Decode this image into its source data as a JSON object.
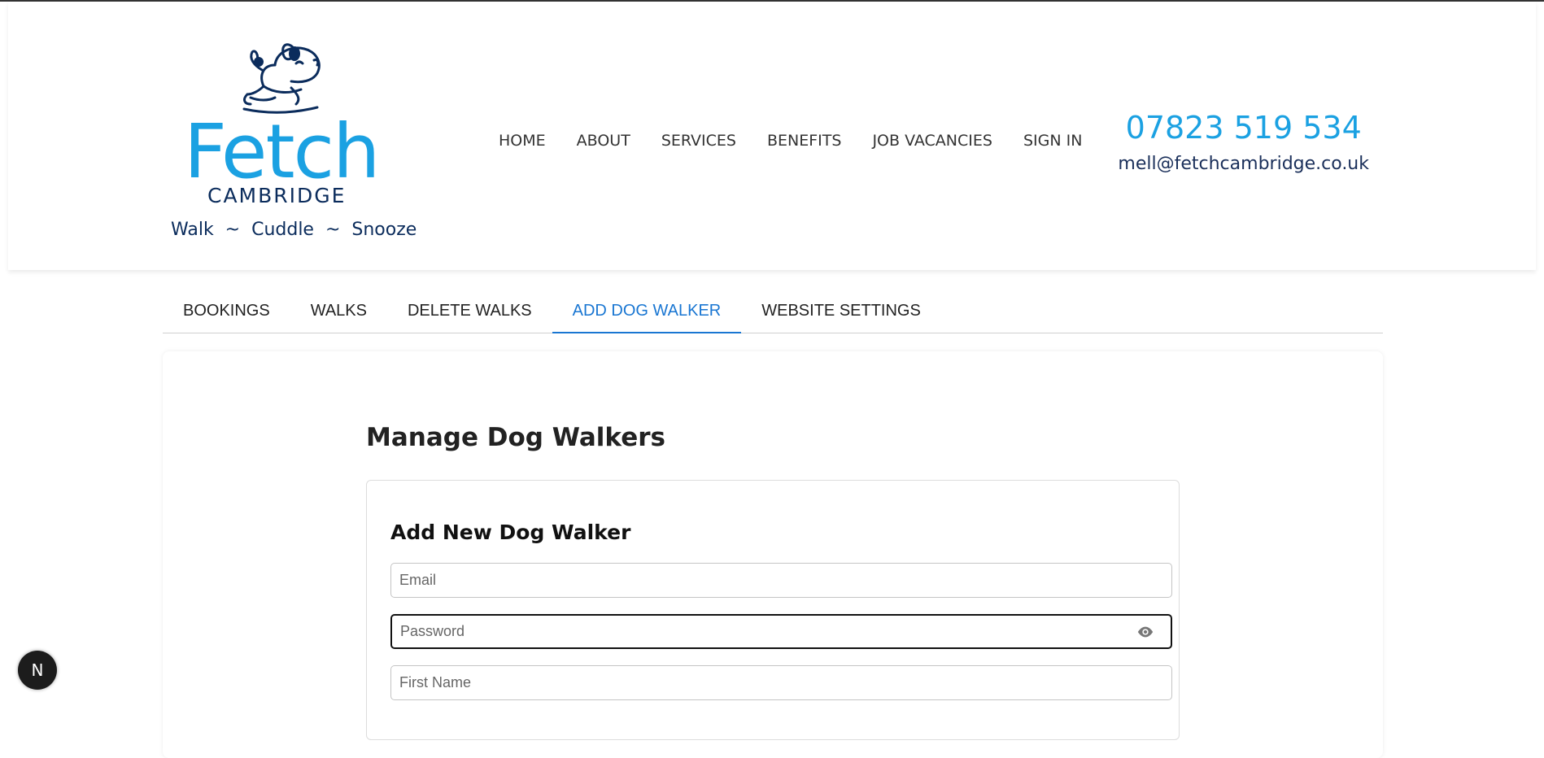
{
  "brand": {
    "name": "Fetch",
    "location": "CAMBRIDGE",
    "tagline": "Walk  ~  Cuddle  ~  Snooze",
    "primary_color": "#1ba1e2",
    "dark_color": "#0b2c5c"
  },
  "nav": {
    "items": [
      {
        "label": "HOME"
      },
      {
        "label": "ABOUT"
      },
      {
        "label": "SERVICES"
      },
      {
        "label": "BENEFITS"
      },
      {
        "label": "JOB VACANCIES"
      },
      {
        "label": "SIGN IN"
      }
    ]
  },
  "contact": {
    "phone": "07823 519 534",
    "email": "mell@fetchcambridge.co.uk"
  },
  "tabs": {
    "items": [
      {
        "label": "BOOKINGS"
      },
      {
        "label": "WALKS"
      },
      {
        "label": "DELETE WALKS"
      },
      {
        "label": "ADD DOG WALKER"
      },
      {
        "label": "WEBSITE SETTINGS"
      }
    ],
    "active": "ADD DOG WALKER",
    "active_color": "#1976d2"
  },
  "main": {
    "title": "Manage Dog Walkers",
    "form": {
      "title": "Add New Dog Walker",
      "email_placeholder": "Email",
      "password_placeholder": "Password",
      "first_name_placeholder": "First Name",
      "email_value": "",
      "password_value": "",
      "first_name_value": ""
    }
  },
  "dev_badge": {
    "label": "N",
    "icon": "nextjs-icon"
  }
}
